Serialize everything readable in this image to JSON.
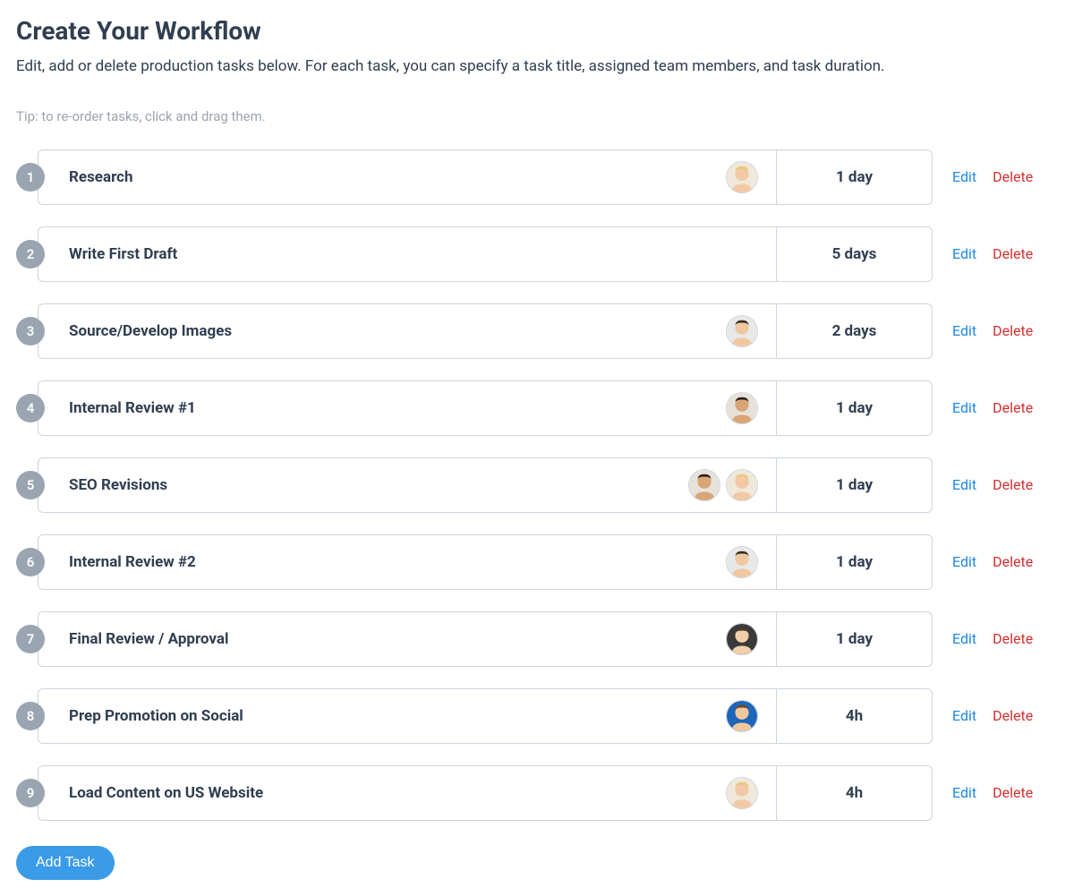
{
  "header": {
    "title": "Create Your Workflow",
    "subtitle": "Edit, add or delete production tasks below. For each task, you can specify a task title, assigned team members, and task duration.",
    "tip": "Tip: to re-order tasks, click and drag them."
  },
  "labels": {
    "edit": "Edit",
    "delete": "Delete",
    "add_task": "Add Task"
  },
  "avatar_styles": {
    "a1": {
      "skin": "#f2c9a4",
      "hair": "#e8c87a",
      "bg": "#efe8db"
    },
    "a2": {
      "skin": "#f0c8a0",
      "hair": "#3a2e24",
      "bg": "#e8e8e8"
    },
    "a3": {
      "skin": "#d9a576",
      "hair": "#2b1f18",
      "bg": "#e6e2da"
    },
    "a4": {
      "skin": "#f1cfa8",
      "hair": "#49392b",
      "bg": "#3a3a3a"
    },
    "a5": {
      "skin": "#f0c8a0",
      "hair": "#6b4a2f",
      "bg": "#1e66b8"
    }
  },
  "tasks": [
    {
      "num": "1",
      "title": "Research",
      "duration": "1 day",
      "avatars": [
        "a1"
      ]
    },
    {
      "num": "2",
      "title": "Write First Draft",
      "duration": "5 days",
      "avatars": []
    },
    {
      "num": "3",
      "title": "Source/Develop Images",
      "duration": "2 days",
      "avatars": [
        "a2"
      ]
    },
    {
      "num": "4",
      "title": "Internal Review #1",
      "duration": "1 day",
      "avatars": [
        "a3"
      ]
    },
    {
      "num": "5",
      "title": "SEO Revisions",
      "duration": "1 day",
      "avatars": [
        "a3",
        "a1"
      ]
    },
    {
      "num": "6",
      "title": "Internal Review #2",
      "duration": "1 day",
      "avatars": [
        "a2"
      ]
    },
    {
      "num": "7",
      "title": "Final Review / Approval",
      "duration": "1 day",
      "avatars": [
        "a4"
      ]
    },
    {
      "num": "8",
      "title": "Prep Promotion on Social",
      "duration": "4h",
      "avatars": [
        "a5"
      ]
    },
    {
      "num": "9",
      "title": "Load Content on US Website",
      "duration": "4h",
      "avatars": [
        "a1"
      ]
    }
  ]
}
